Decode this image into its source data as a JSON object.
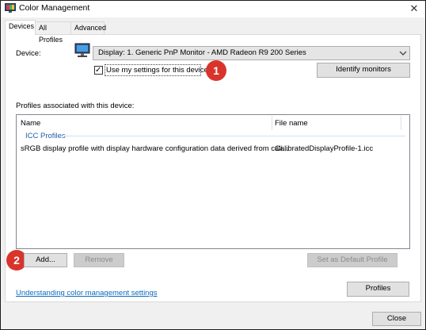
{
  "window": {
    "title": "Color Management",
    "close_glyph": "✕"
  },
  "tabs": [
    {
      "label": "Devices",
      "active": true
    },
    {
      "label": "All Profiles",
      "active": false
    },
    {
      "label": "Advanced",
      "active": false
    }
  ],
  "device": {
    "label": "Device:",
    "selected": "Display: 1. Generic PnP Monitor - AMD Radeon R9 200 Series",
    "checkbox_label": "Use my settings for this device",
    "checkbox_checked": true,
    "identify_label": "Identify monitors"
  },
  "profiles_section": {
    "label": "Profiles associated with this device:",
    "columns": [
      "Name",
      "File name"
    ],
    "group": "ICC Profiles",
    "rows": [
      {
        "name": "sRGB display profile with display hardware configuration data derived from cali...",
        "file": "CalibratedDisplayProfile-1.icc"
      }
    ]
  },
  "buttons": {
    "add": "Add...",
    "remove": "Remove",
    "set_default": "Set as Default Profile",
    "profiles": "Profiles",
    "close": "Close"
  },
  "link": "Understanding color management settings",
  "annotations": {
    "badge1": "1",
    "badge2": "2",
    "color": "#d9342b"
  }
}
